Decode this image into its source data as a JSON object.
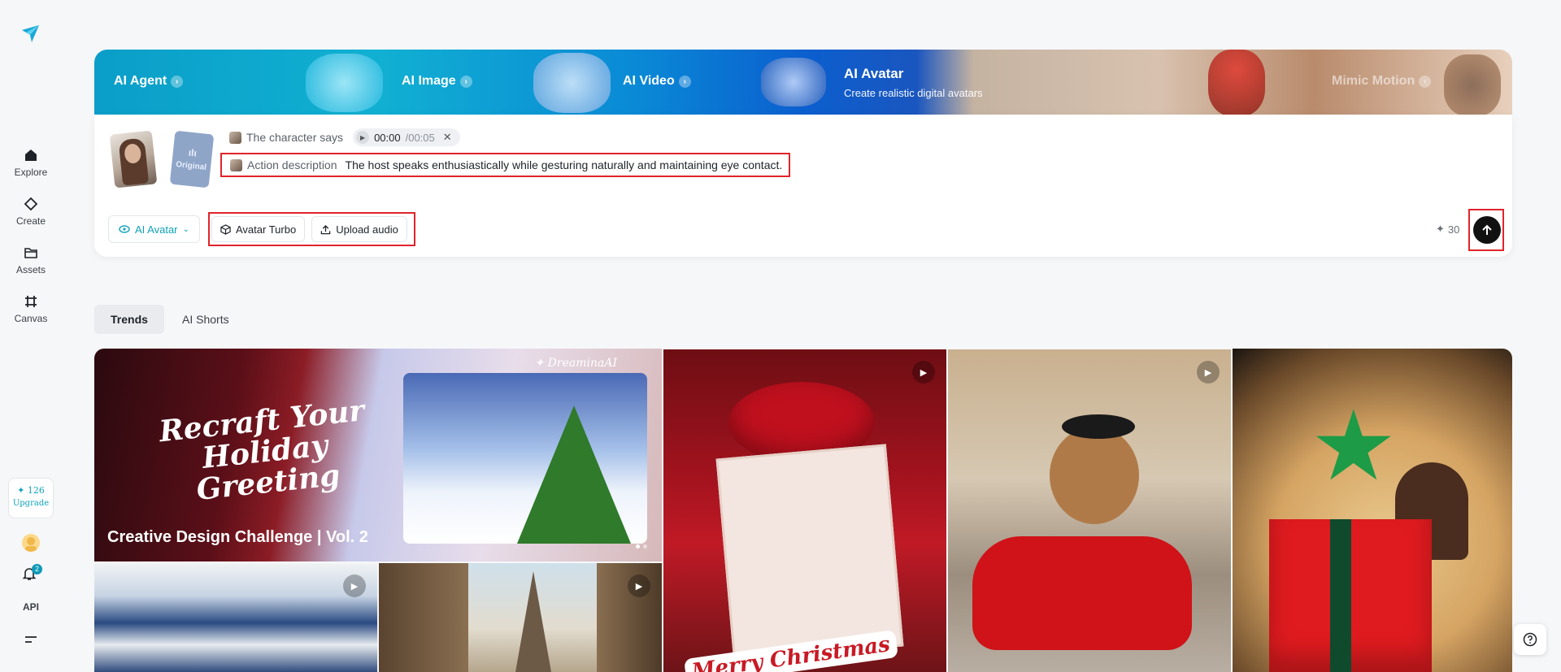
{
  "sidebar": {
    "logo": "dreamina-logo-icon",
    "items": [
      {
        "label": "Explore",
        "icon": "home-icon"
      },
      {
        "label": "Create",
        "icon": "diamond-icon"
      },
      {
        "label": "Assets",
        "icon": "folder-icon"
      },
      {
        "label": "Canvas",
        "icon": "canvas-icon"
      }
    ],
    "credits": "126",
    "upgrade_label": "Upgrade",
    "notification_count": "2",
    "api_label": "API",
    "menu_icon": "menu-icon"
  },
  "banner": {
    "tabs": [
      {
        "label": "AI Agent"
      },
      {
        "label": "AI Image"
      },
      {
        "label": "AI Video"
      },
      {
        "label": "Mimic Motion"
      }
    ],
    "active": {
      "label": "AI Avatar",
      "subtitle": "Create realistic digital avatars"
    }
  },
  "prompt": {
    "thumb_audio_label": "Original",
    "character_says_label": "The character says",
    "audio_time": "00:00",
    "audio_duration": "/00:05",
    "action_label": "Action description",
    "action_text": "The host speaks enthusiastically while gesturing naturally and maintaining eye contact.",
    "mode_label": "AI Avatar",
    "tool_model_label": "Avatar Turbo",
    "tool_upload_label": "Upload audio",
    "cost": "30"
  },
  "feed": {
    "tabs": [
      {
        "label": "Trends",
        "active": true
      },
      {
        "label": "AI Shorts",
        "active": false
      }
    ],
    "hero": {
      "headline": "Recraft Your Holiday Greeting",
      "brand": "✦ DreaminaAI",
      "caption": "Creative Design Challenge | Vol. 2"
    },
    "card_text": "Merry Christmas"
  },
  "colors": {
    "accent": "#10a3b8",
    "highlight_border": "#e0242b",
    "send_button": "#111111"
  }
}
